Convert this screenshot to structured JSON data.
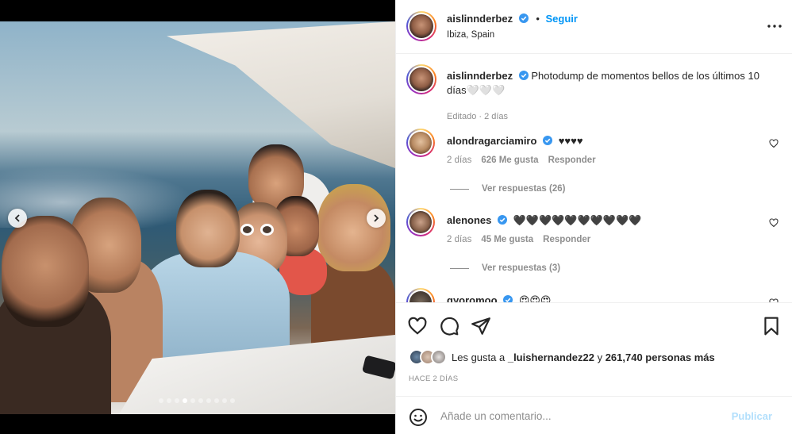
{
  "header": {
    "username": "aislinnderbez",
    "follow_label": "Seguir",
    "location": "Ibiza, Spain"
  },
  "caption": {
    "username": "aislinnderbez",
    "text": "Photodump de momentos bellos de los últimos 10 días🤍🤍🤍",
    "edited": "Editado · 2 días"
  },
  "comments": [
    {
      "username": "alondragarciamiro",
      "text": "♥♥♥♥",
      "age": "2 días",
      "likes": "626 Me gusta",
      "reply_label": "Responder",
      "view_replies": "Ver respuestas (26)"
    },
    {
      "username": "alenones",
      "text": "🖤🖤🖤🖤🖤🖤🖤🖤🖤🖤",
      "age": "2 días",
      "likes": "45 Me gusta",
      "reply_label": "Responder",
      "view_replies": "Ver respuestas (3)"
    },
    {
      "username": "gyoromoo",
      "text": "😍😍😍"
    }
  ],
  "likes": {
    "prefix": "Les gusta a",
    "user": "_luishernandez22",
    "middle": "y",
    "count": "261,740 personas más"
  },
  "timestamp": "HACE 2 DÍAS",
  "comment_box": {
    "placeholder": "Añade un comentario...",
    "post_label": "Publicar"
  },
  "carousel": {
    "total": 10,
    "active_index": 3
  },
  "colors": {
    "link_blue": "#0095f6",
    "post_disabled": "#b2dffc",
    "muted_text": "#8e8e8e",
    "text": "#262626",
    "divider": "#efefef"
  }
}
